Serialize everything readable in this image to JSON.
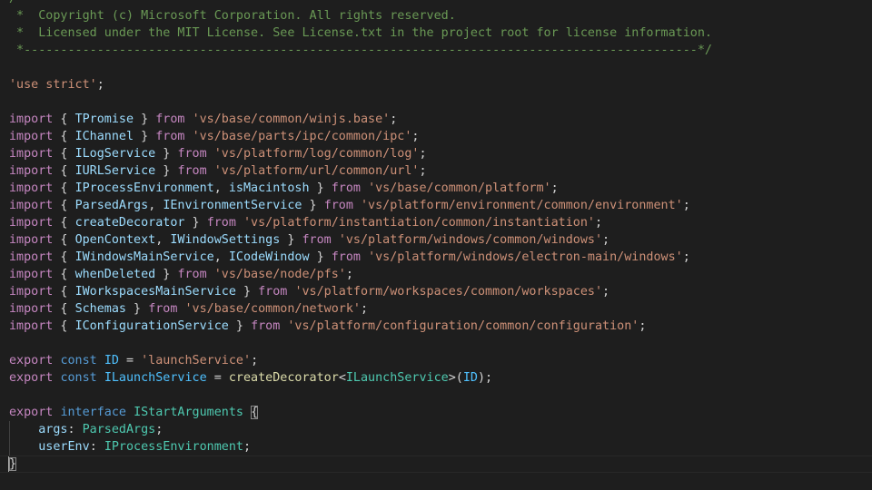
{
  "editor": {
    "language": "typescript",
    "theme_colors": {
      "background": "#1e1e1e",
      "comment": "#6a9955",
      "string": "#ce9178",
      "keyword": "#569cd6",
      "control": "#c586c0",
      "type": "#4ec9b0",
      "variable": "#9cdcfe",
      "function": "#dcdcaa",
      "constant": "#4fc1ff",
      "text": "#d4d4d4"
    },
    "lines": [
      [
        [
          "comment",
          "/*---------------------------------------------------------------------------------------------"
        ]
      ],
      [
        [
          "comment",
          " *  Copyright (c) Microsoft Corporation. All rights reserved."
        ]
      ],
      [
        [
          "comment",
          " *  Licensed under the MIT License. See License.txt in the project root for license information."
        ]
      ],
      [
        [
          "comment",
          " *--------------------------------------------------------------------------------------------*/"
        ]
      ],
      [],
      [
        [
          "string",
          "'use strict'"
        ],
        [
          "punct",
          ";"
        ]
      ],
      [],
      [
        [
          "control",
          "import"
        ],
        [
          "punct",
          " { "
        ],
        [
          "variable",
          "TPromise"
        ],
        [
          "punct",
          " } "
        ],
        [
          "control",
          "from"
        ],
        [
          "punct",
          " "
        ],
        [
          "string",
          "'vs/base/common/winjs.base'"
        ],
        [
          "punct",
          ";"
        ]
      ],
      [
        [
          "control",
          "import"
        ],
        [
          "punct",
          " { "
        ],
        [
          "variable",
          "IChannel"
        ],
        [
          "punct",
          " } "
        ],
        [
          "control",
          "from"
        ],
        [
          "punct",
          " "
        ],
        [
          "string",
          "'vs/base/parts/ipc/common/ipc'"
        ],
        [
          "punct",
          ";"
        ]
      ],
      [
        [
          "control",
          "import"
        ],
        [
          "punct",
          " { "
        ],
        [
          "variable",
          "ILogService"
        ],
        [
          "punct",
          " } "
        ],
        [
          "control",
          "from"
        ],
        [
          "punct",
          " "
        ],
        [
          "string",
          "'vs/platform/log/common/log'"
        ],
        [
          "punct",
          ";"
        ]
      ],
      [
        [
          "control",
          "import"
        ],
        [
          "punct",
          " { "
        ],
        [
          "variable",
          "IURLService"
        ],
        [
          "punct",
          " } "
        ],
        [
          "control",
          "from"
        ],
        [
          "punct",
          " "
        ],
        [
          "string",
          "'vs/platform/url/common/url'"
        ],
        [
          "punct",
          ";"
        ]
      ],
      [
        [
          "control",
          "import"
        ],
        [
          "punct",
          " { "
        ],
        [
          "variable",
          "IProcessEnvironment"
        ],
        [
          "punct",
          ", "
        ],
        [
          "variable",
          "isMacintosh"
        ],
        [
          "punct",
          " } "
        ],
        [
          "control",
          "from"
        ],
        [
          "punct",
          " "
        ],
        [
          "string",
          "'vs/base/common/platform'"
        ],
        [
          "punct",
          ";"
        ]
      ],
      [
        [
          "control",
          "import"
        ],
        [
          "punct",
          " { "
        ],
        [
          "variable",
          "ParsedArgs"
        ],
        [
          "punct",
          ", "
        ],
        [
          "variable",
          "IEnvironmentService"
        ],
        [
          "punct",
          " } "
        ],
        [
          "control",
          "from"
        ],
        [
          "punct",
          " "
        ],
        [
          "string",
          "'vs/platform/environment/common/environment'"
        ],
        [
          "punct",
          ";"
        ]
      ],
      [
        [
          "control",
          "import"
        ],
        [
          "punct",
          " { "
        ],
        [
          "variable",
          "createDecorator"
        ],
        [
          "punct",
          " } "
        ],
        [
          "control",
          "from"
        ],
        [
          "punct",
          " "
        ],
        [
          "string",
          "'vs/platform/instantiation/common/instantiation'"
        ],
        [
          "punct",
          ";"
        ]
      ],
      [
        [
          "control",
          "import"
        ],
        [
          "punct",
          " { "
        ],
        [
          "variable",
          "OpenContext"
        ],
        [
          "punct",
          ", "
        ],
        [
          "variable",
          "IWindowSettings"
        ],
        [
          "punct",
          " } "
        ],
        [
          "control",
          "from"
        ],
        [
          "punct",
          " "
        ],
        [
          "string",
          "'vs/platform/windows/common/windows'"
        ],
        [
          "punct",
          ";"
        ]
      ],
      [
        [
          "control",
          "import"
        ],
        [
          "punct",
          " { "
        ],
        [
          "variable",
          "IWindowsMainService"
        ],
        [
          "punct",
          ", "
        ],
        [
          "variable",
          "ICodeWindow"
        ],
        [
          "punct",
          " } "
        ],
        [
          "control",
          "from"
        ],
        [
          "punct",
          " "
        ],
        [
          "string",
          "'vs/platform/windows/electron-main/windows'"
        ],
        [
          "punct",
          ";"
        ]
      ],
      [
        [
          "control",
          "import"
        ],
        [
          "punct",
          " { "
        ],
        [
          "variable",
          "whenDeleted"
        ],
        [
          "punct",
          " } "
        ],
        [
          "control",
          "from"
        ],
        [
          "punct",
          " "
        ],
        [
          "string",
          "'vs/base/node/pfs'"
        ],
        [
          "punct",
          ";"
        ]
      ],
      [
        [
          "control",
          "import"
        ],
        [
          "punct",
          " { "
        ],
        [
          "variable",
          "IWorkspacesMainService"
        ],
        [
          "punct",
          " } "
        ],
        [
          "control",
          "from"
        ],
        [
          "punct",
          " "
        ],
        [
          "string",
          "'vs/platform/workspaces/common/workspaces'"
        ],
        [
          "punct",
          ";"
        ]
      ],
      [
        [
          "control",
          "import"
        ],
        [
          "punct",
          " { "
        ],
        [
          "variable",
          "Schemas"
        ],
        [
          "punct",
          " } "
        ],
        [
          "control",
          "from"
        ],
        [
          "punct",
          " "
        ],
        [
          "string",
          "'vs/base/common/network'"
        ],
        [
          "punct",
          ";"
        ]
      ],
      [
        [
          "control",
          "import"
        ],
        [
          "punct",
          " { "
        ],
        [
          "variable",
          "IConfigurationService"
        ],
        [
          "punct",
          " } "
        ],
        [
          "control",
          "from"
        ],
        [
          "punct",
          " "
        ],
        [
          "string",
          "'vs/platform/configuration/common/configuration'"
        ],
        [
          "punct",
          ";"
        ]
      ],
      [],
      [
        [
          "control",
          "export"
        ],
        [
          "punct",
          " "
        ],
        [
          "keyword",
          "const"
        ],
        [
          "punct",
          " "
        ],
        [
          "constant",
          "ID"
        ],
        [
          "punct",
          " = "
        ],
        [
          "string",
          "'launchService'"
        ],
        [
          "punct",
          ";"
        ]
      ],
      [
        [
          "control",
          "export"
        ],
        [
          "punct",
          " "
        ],
        [
          "keyword",
          "const"
        ],
        [
          "punct",
          " "
        ],
        [
          "constant",
          "ILaunchService"
        ],
        [
          "punct",
          " = "
        ],
        [
          "function",
          "createDecorator"
        ],
        [
          "punct",
          "<"
        ],
        [
          "type",
          "ILaunchService"
        ],
        [
          "punct",
          ">("
        ],
        [
          "constant",
          "ID"
        ],
        [
          "punct",
          ");"
        ]
      ],
      [],
      [
        [
          "control",
          "export"
        ],
        [
          "punct",
          " "
        ],
        [
          "keyword",
          "interface"
        ],
        [
          "punct",
          " "
        ],
        [
          "type",
          "IStartArguments"
        ],
        [
          "punct",
          " "
        ],
        [
          "bracket",
          "{"
        ]
      ],
      [
        [
          "punct",
          "    "
        ],
        [
          "variable",
          "args"
        ],
        [
          "punct",
          ": "
        ],
        [
          "type",
          "ParsedArgs"
        ],
        [
          "punct",
          ";"
        ]
      ],
      [
        [
          "punct",
          "    "
        ],
        [
          "variable",
          "userEnv"
        ],
        [
          "punct",
          ": "
        ],
        [
          "type",
          "IProcessEnvironment"
        ],
        [
          "punct",
          ";"
        ]
      ],
      [
        [
          "cursor",
          ""
        ],
        [
          "bracket",
          "}"
        ]
      ]
    ],
    "current_line_index": 27,
    "indent_guide_lines": [
      25,
      26
    ]
  }
}
